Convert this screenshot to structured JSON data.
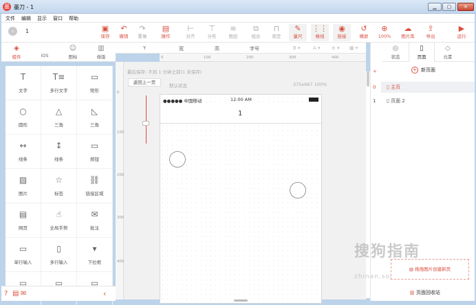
{
  "window": {
    "title": "墨刀 - 1",
    "app_icon": "墨"
  },
  "menu": [
    "文件",
    "编辑",
    "显示",
    "窗口",
    "帮助"
  ],
  "toolbar": {
    "page_num": "1",
    "tools": [
      {
        "label": "保存",
        "icon": "save-icon",
        "glyph": "▣",
        "style": "red"
      },
      {
        "label": "撤销",
        "icon": "undo-icon",
        "glyph": "↶",
        "style": "red"
      },
      {
        "label": "重做",
        "icon": "redo-icon",
        "glyph": "↷",
        "style": "gray"
      },
      {
        "label": "操作",
        "icon": "action-icon",
        "glyph": "▤",
        "style": "red"
      },
      {
        "label": "对齐",
        "icon": "align-icon",
        "glyph": "⊢",
        "style": "gray"
      },
      {
        "label": "分布",
        "icon": "distribute-icon",
        "glyph": "⊤",
        "style": "gray"
      },
      {
        "label": "图层",
        "icon": "layer-icon",
        "glyph": "≡",
        "style": "gray"
      },
      {
        "label": "组合",
        "icon": "group-icon",
        "glyph": "⧉",
        "style": "gray"
      },
      {
        "label": "锁定",
        "icon": "lock-icon",
        "glyph": "⊓",
        "style": "gray"
      },
      {
        "label": "量尺",
        "icon": "ruler-icon",
        "glyph": "✎",
        "style": "red sel"
      },
      {
        "label": "格线",
        "icon": "grid-icon",
        "glyph": "⋮⋮",
        "style": "red sel"
      },
      {
        "label": "链接",
        "icon": "eye-icon",
        "glyph": "◉",
        "style": "red sel"
      },
      {
        "label": "横屏",
        "icon": "rotate-icon",
        "glyph": "↺",
        "style": "red"
      },
      {
        "label": "100%",
        "icon": "zoom-icon",
        "glyph": "⊕",
        "style": "red"
      },
      {
        "label": "图片库",
        "icon": "cloud-icon",
        "glyph": "☁",
        "style": "red"
      },
      {
        "label": "导出",
        "icon": "export-icon",
        "glyph": "⇪",
        "style": "red"
      },
      {
        "label": "运行",
        "icon": "play-icon",
        "glyph": "▶",
        "style": "red"
      }
    ]
  },
  "props": [
    "Y",
    "宽",
    "高",
    "字号",
    "B ▾",
    "A ▾",
    "≡ ▾",
    "▦ ▾"
  ],
  "left_tabs": [
    {
      "label": "组件",
      "icon": "cube-icon",
      "glyph": "◈"
    },
    {
      "label": "iOS",
      "icon": "apple-icon",
      "glyph": ""
    },
    {
      "label": "图标",
      "icon": "smile-icon",
      "glyph": "☺"
    },
    {
      "label": "母版",
      "icon": "master-icon",
      "glyph": "▥"
    }
  ],
  "components": [
    {
      "label": "文字",
      "icon": "text-icon",
      "glyph": "T"
    },
    {
      "label": "多行文字",
      "icon": "multitext-icon",
      "glyph": "T≡"
    },
    {
      "label": "矩形",
      "icon": "rect-icon",
      "glyph": "▭"
    },
    {
      "label": "圆形",
      "icon": "circle-icon",
      "glyph": "○"
    },
    {
      "label": "三角",
      "icon": "triangle-icon",
      "glyph": "△"
    },
    {
      "label": "三角",
      "icon": "right-triangle-icon",
      "glyph": "◺"
    },
    {
      "label": "线条",
      "icon": "hline-icon",
      "glyph": "↔"
    },
    {
      "label": "线条",
      "icon": "vline-icon",
      "glyph": "↕"
    },
    {
      "label": "按钮",
      "icon": "button-icon",
      "glyph": "▭"
    },
    {
      "label": "图片",
      "icon": "image-icon",
      "glyph": "▨"
    },
    {
      "label": "标签",
      "icon": "star-icon",
      "glyph": "☆"
    },
    {
      "label": "链接区域",
      "icon": "link-area-icon",
      "glyph": "⛓"
    },
    {
      "label": "网页",
      "icon": "webpage-icon",
      "glyph": "▤"
    },
    {
      "label": "全局手势",
      "icon": "gesture-icon",
      "glyph": "☝"
    },
    {
      "label": "批注",
      "icon": "note-icon",
      "glyph": "✉"
    },
    {
      "label": "单行输入",
      "icon": "input-icon",
      "glyph": "▭"
    },
    {
      "label": "多行输入",
      "icon": "textarea-icon",
      "glyph": "▯"
    },
    {
      "label": "下拉框",
      "icon": "dropdown-icon",
      "glyph": "▾"
    },
    {
      "label": "",
      "icon": "folder-icon",
      "glyph": "▭"
    },
    {
      "label": "",
      "icon": "toggle-icon",
      "glyph": "▭"
    },
    {
      "label": "",
      "icon": "clipboard-icon",
      "glyph": "▭"
    }
  ],
  "ruler_h": [
    "0",
    "100",
    "200",
    "300",
    "400"
  ],
  "ruler_v": [
    "0",
    "100",
    "200",
    "300",
    "400"
  ],
  "canvas": {
    "autosave": "最后保存: 不到 1 分钟之前(1 未保存)",
    "back_btn": "返回上一页",
    "state": "默认状态",
    "size": "375x667 100%"
  },
  "phone": {
    "carrier": "●●●●● 中国移动",
    "time": "12:00 AM",
    "nav_title": "1"
  },
  "right_tabs": [
    {
      "label": "状态",
      "icon": "state-icon",
      "glyph": "◎"
    },
    {
      "label": "页面",
      "icon": "page-icon",
      "glyph": "▯"
    },
    {
      "label": "元素",
      "icon": "element-icon",
      "glyph": "◇"
    }
  ],
  "pages": {
    "new_page": "新页面",
    "items": [
      {
        "index": "0",
        "label": "主页"
      },
      {
        "index": "1",
        "label": "页面 2"
      }
    ],
    "drag_hint": "拖拽图片创建新页",
    "recycle": "页面回收站",
    "plus": "+"
  },
  "watermark": {
    "main": "搜狗指南",
    "sub": "zhinan.sogou.com"
  }
}
